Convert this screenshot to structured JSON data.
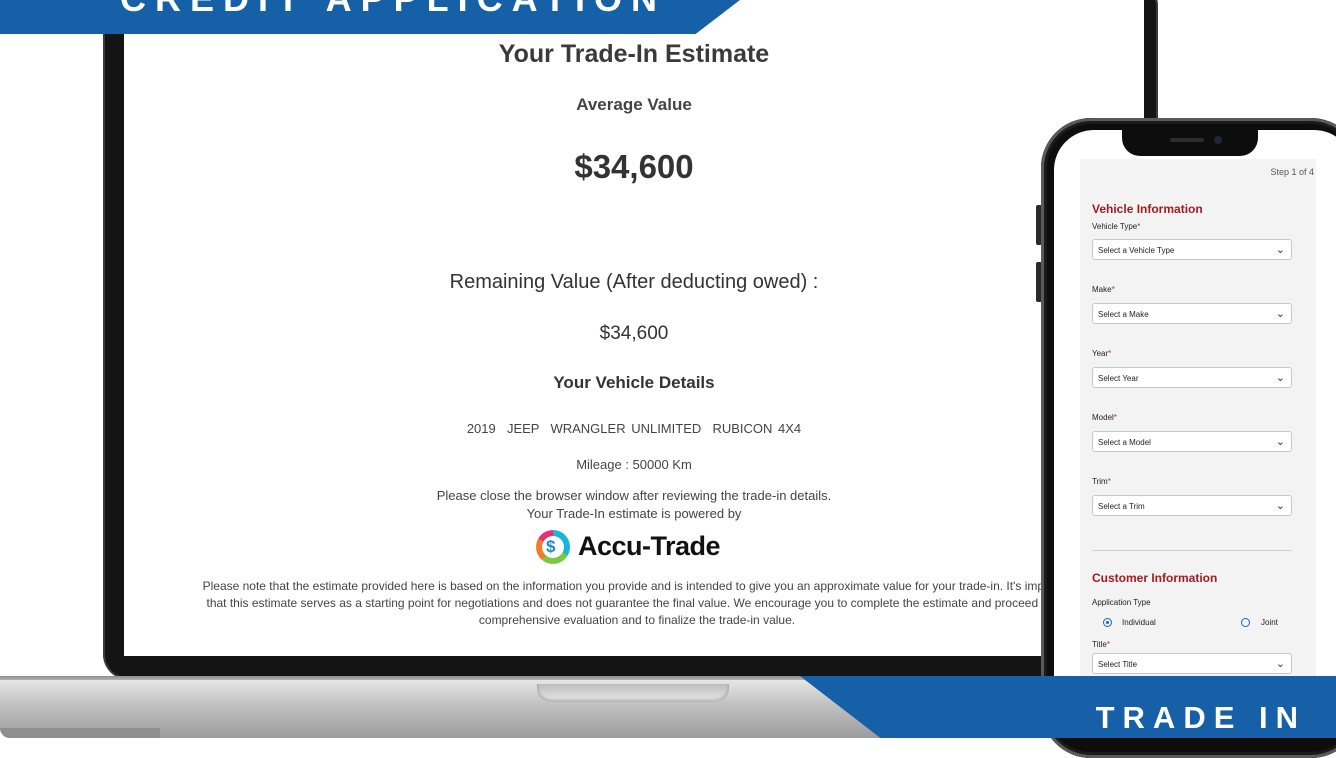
{
  "banners": {
    "top": "CREDIT APPLICATION",
    "bottom": "TRADE IN"
  },
  "estimate": {
    "title": "Your Trade-In Estimate",
    "average_label": "Average Value",
    "average_value": "$34,600",
    "remaining_label": "Remaining Value (After deducting owed) :",
    "remaining_value": "$34,600",
    "details_title": "Your Vehicle Details",
    "vehicle": "2019  JEEP  WRANGLER UNLIMITED  RUBICON 4X4",
    "mileage": "Mileage : 50000 Km",
    "close_note": "Please close the browser window after reviewing the trade-in details.",
    "powered_by": "Your Trade-In estimate is powered by",
    "logo_symbol": "$",
    "logo_text": "Accu-Trade",
    "disclaimer_line1": "Please note that the estimate provided here is based on the information you provide and is intended to give you an approximate value for your trade-in. It's importan",
    "disclaimer_line2": "that this estimate serves as a starting point for negotiations and does not guarantee the final value. We encourage you to complete the estimate and proceed to co",
    "disclaimer_line3": "comprehensive evaluation and to finalize the trade-in value."
  },
  "phone_form": {
    "step": "Step 1 of 4",
    "vehicle_section": "Vehicle Information",
    "fields": {
      "vehicle_type": {
        "label": "Vehicle Type",
        "placeholder": "Select a Vehicle Type"
      },
      "make": {
        "label": "Make",
        "placeholder": "Select a Make"
      },
      "year": {
        "label": "Year",
        "placeholder": "Select Year"
      },
      "model": {
        "label": "Model",
        "placeholder": "Select a Model"
      },
      "trim": {
        "label": "Trim",
        "placeholder": "Select a Trim"
      },
      "title": {
        "label": "Title",
        "placeholder": "Select Title"
      }
    },
    "required_mark": "*",
    "chevron": "⌄",
    "customer_section": "Customer Information",
    "application_type": {
      "label": "Application Type",
      "options": [
        "Individual",
        "Joint"
      ],
      "selected": "Individual"
    }
  },
  "colors": {
    "banner": "#1560a6",
    "form_heading": "#a01c24",
    "radio": "#1565c0"
  }
}
